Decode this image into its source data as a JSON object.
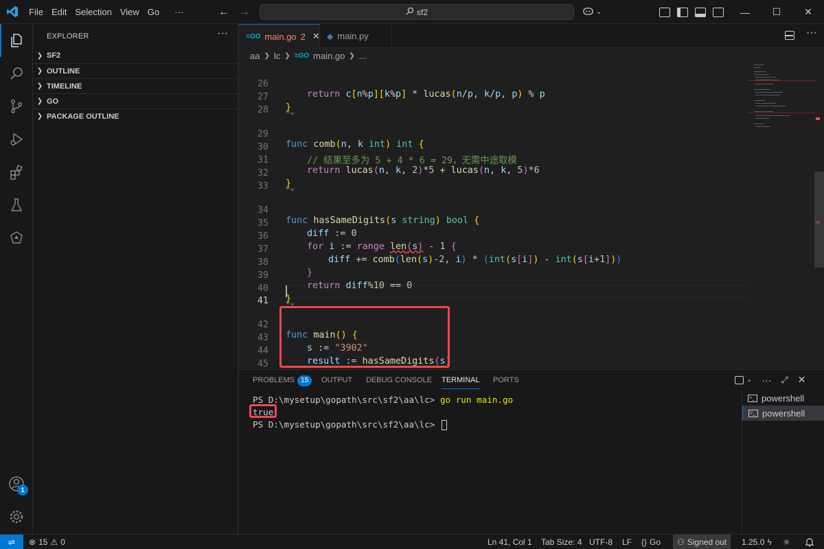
{
  "titlebar": {
    "menu": [
      "File",
      "Edit",
      "Selection",
      "View",
      "Go",
      "···"
    ],
    "search_text": "sf2"
  },
  "sidebar": {
    "title": "EXPLORER",
    "sections": [
      "SF2",
      "OUTLINE",
      "TIMELINE",
      "GO",
      "PACKAGE OUTLINE"
    ]
  },
  "tabs": [
    {
      "label": "main.go",
      "problems": "2",
      "icon": "go-file-icon",
      "active": true
    },
    {
      "label": "main.py",
      "icon": "python-file-icon",
      "active": false
    }
  ],
  "breadcrumb": [
    "aa",
    "lc",
    "main.go",
    "..."
  ],
  "editor": {
    "lens_glyph": "⚛⌄",
    "line_numbers": [
      "26",
      "27",
      "28",
      "29",
      "30",
      "31",
      "32",
      "33",
      "34",
      "35",
      "36",
      "37",
      "38",
      "39",
      "40",
      "41",
      "42",
      "43",
      "44",
      "45"
    ],
    "current_line": "41",
    "comment_line": "// 结果至多为 5 + 4 * 6 = 29，无需中途取模",
    "main_string": "\"3902\""
  },
  "panel": {
    "tabs": [
      "PROBLEMS",
      "OUTPUT",
      "DEBUG CONSOLE",
      "TERMINAL",
      "PORTS"
    ],
    "problems_count": "15",
    "active_tab": "TERMINAL",
    "terminal": {
      "prompt": "PS D:\\mysetup\\gopath\\src\\sf2\\aa\\lc> ",
      "command": "go run main.go",
      "output": "true"
    },
    "terminal_list": [
      "powershell",
      "powershell"
    ]
  },
  "statusbar": {
    "errors": "15",
    "warnings": "0",
    "position": "Ln 41, Col 1",
    "tab_size": "Tab Size: 4",
    "encoding": "UTF-8",
    "eol": "LF",
    "language": "Go",
    "account": "Signed out",
    "go_version": "1.25.0"
  },
  "colors": {
    "accent": "#0078d4",
    "highlight_box": "#f0474e",
    "error": "#f14c4c"
  }
}
